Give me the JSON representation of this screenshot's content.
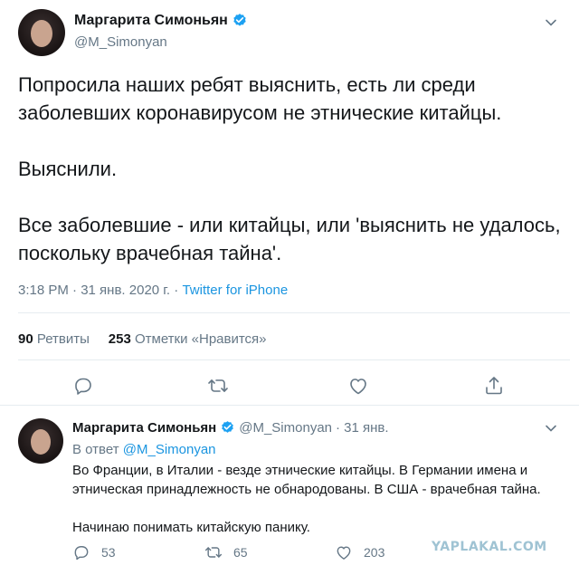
{
  "main_tweet": {
    "display_name": "Маргарита Симоньян",
    "handle": "@M_Simonyan",
    "text": "Попросила наших ребят выяснить, есть ли среди заболевших коронавирусом не этнические китайцы.\n\nВыяснили.\n\nВсе заболевшие - или китайцы, или 'выяснить не удалось, поскольку врачебная тайна'.",
    "timestamp": "3:18 PM · 31 янв. 2020 г. · ",
    "source": "Twitter for iPhone",
    "retweets_count": "90",
    "retweets_label": "Ретвиты",
    "likes_count": "253",
    "likes_label": "Отметки «Нравится»",
    "actions": [
      "reply-icon",
      "retweet-icon",
      "like-icon",
      "share-icon"
    ]
  },
  "reply_tweet": {
    "display_name": "Маргарита Симоньян",
    "handle": "@M_Simonyan",
    "date": "· 31 янв.",
    "in_reply_prefix": "В ответ ",
    "in_reply_handle": "@M_Simonyan",
    "text": "Во Франции, в Италии - везде этнические китайцы. В Германии имена и этническая принадлежность не обнародованы. В США - врачебная тайна.\n\nНачинаю понимать китайскую панику.",
    "replies": "53",
    "retweets": "65",
    "likes": "203"
  },
  "watermark": "YAPLAKAL.COM",
  "colors": {
    "accent": "#1b95e0",
    "muted": "#657786",
    "text": "#14171a",
    "verified": "#1da1f2"
  }
}
